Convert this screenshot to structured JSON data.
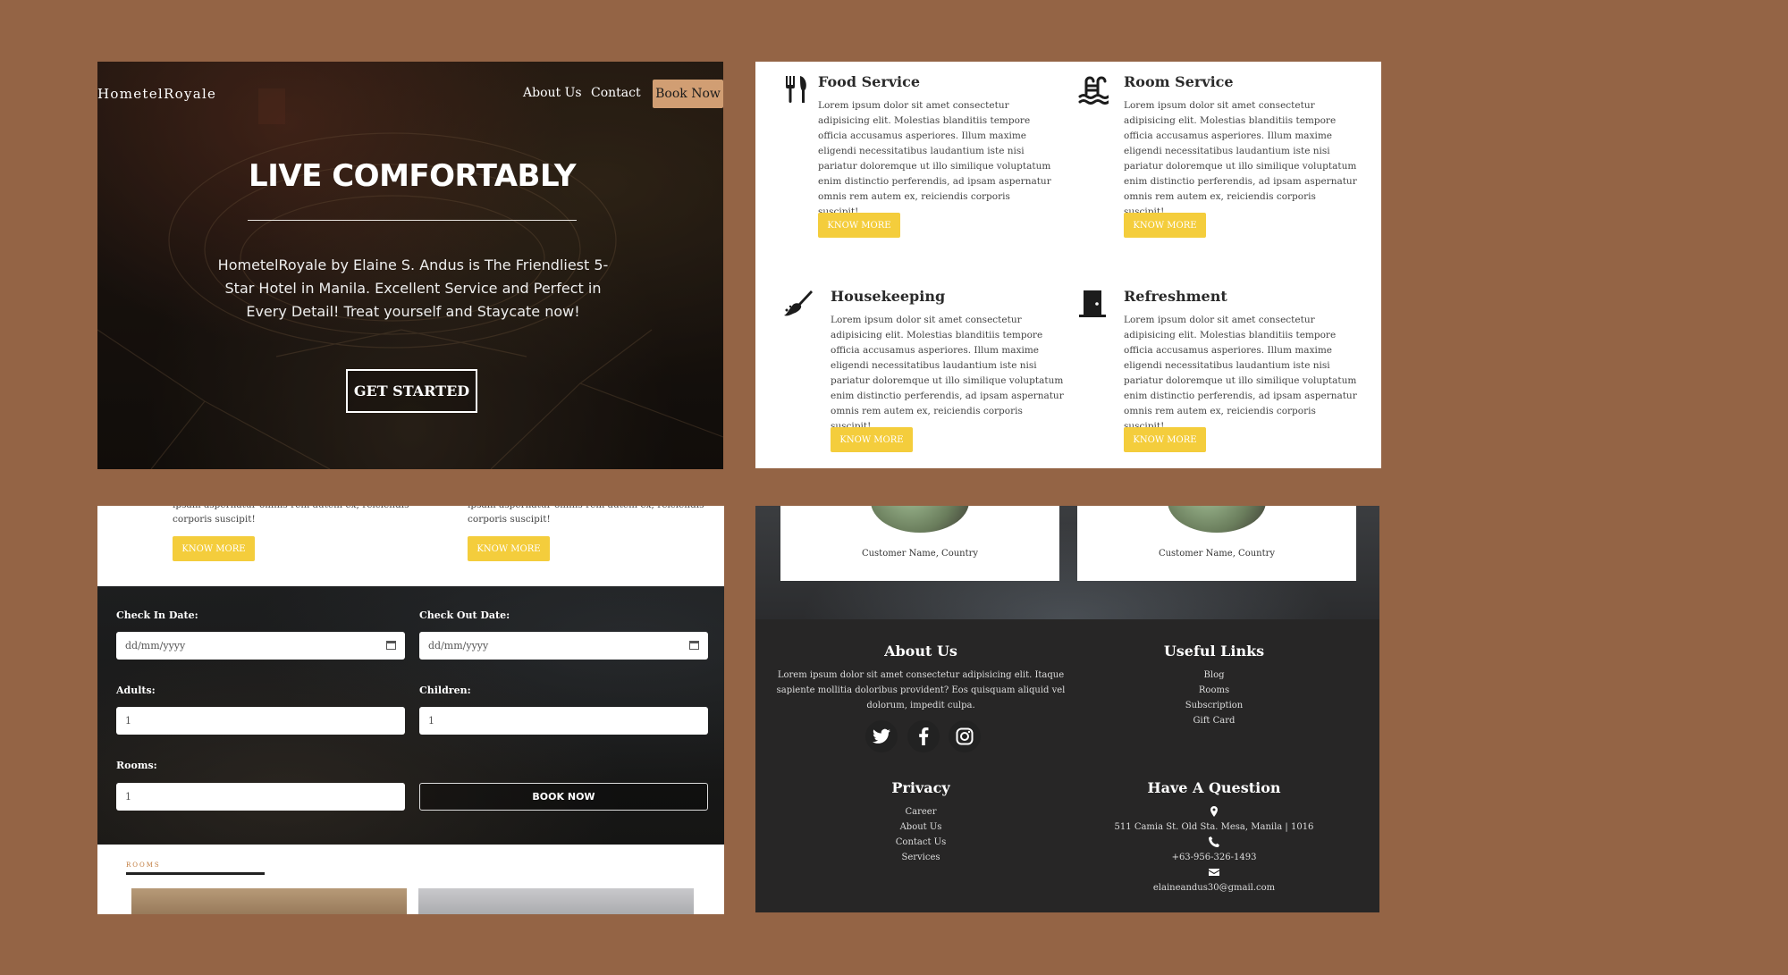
{
  "hero": {
    "brand": "HometelRoyale",
    "nav": [
      "About Us",
      "Contact"
    ],
    "book_now": "Book Now",
    "title": "LIVE COMFORTABLY",
    "description": "HometelRoyale by Elaine S. Andus is The Friendliest 5-Star Hotel in Manila. Excellent Service and Perfect in Every Detail! Treat yourself and Staycate now!",
    "cta": "GET STARTED"
  },
  "services": {
    "items": [
      {
        "title": "Food Service",
        "icon": "fork-knife-icon",
        "text": "Lorem ipsum dolor sit amet consectetur adipisicing elit. Molestias blanditiis tempore officia accusamus asperiores. Illum maxime eligendi necessitatibus laudantium iste nisi pariatur doloremque ut illo similique voluptatum enim distinctio perferendis, ad ipsam aspernatur omnis rem autem ex, reiciendis corporis suscipit!",
        "button": "KNOW MORE"
      },
      {
        "title": "Room Service",
        "icon": "swimming-pool-icon",
        "text": "Lorem ipsum dolor sit amet consectetur adipisicing elit. Molestias blanditiis tempore officia accusamus asperiores. Illum maxime eligendi necessitatibus laudantium iste nisi pariatur doloremque ut illo similique voluptatum enim distinctio perferendis, ad ipsam aspernatur omnis rem autem ex, reiciendis corporis suscipit!",
        "button": "KNOW MORE"
      },
      {
        "title": "Housekeeping",
        "icon": "broom-icon",
        "text": "Lorem ipsum dolor sit amet consectetur adipisicing elit. Molestias blanditiis tempore officia accusamus asperiores. Illum maxime eligendi necessitatibus laudantium iste nisi pariatur doloremque ut illo similique voluptatum enim distinctio perferendis, ad ipsam aspernatur omnis rem autem ex, reiciendis corporis suscipit!",
        "button": "KNOW MORE"
      },
      {
        "title": "Refreshment",
        "icon": "door-icon",
        "text": "Lorem ipsum dolor sit amet consectetur adipisicing elit. Molestias blanditiis tempore officia accusamus asperiores. Illum maxime eligendi necessitatibus laudantium iste nisi pariatur doloremque ut illo similique voluptatum enim distinctio perferendis, ad ipsam aspernatur omnis rem autem ex, reiciendis corporis suscipit!",
        "button": "KNOW MORE"
      }
    ]
  },
  "booking": {
    "top_text_cut": "ipsam aspernatur omnis rem autem ex, reiciendis",
    "top_text": "corporis suscipit!",
    "know_more": "KNOW MORE",
    "check_in_label": "Check In Date:",
    "check_out_label": "Check Out Date:",
    "date_placeholder": "dd/mm/yyyy",
    "adults_label": "Adults:",
    "children_label": "Children:",
    "rooms_label": "Rooms:",
    "adults_value": "1",
    "children_value": "1",
    "rooms_value": "1",
    "submit": "BOOK NOW",
    "rooms_section": "ROOMS"
  },
  "footer": {
    "customer_name": "Customer Name, Country",
    "about_heading": "About Us",
    "about_text": "Lorem ipsum dolor sit amet consectetur adipisicing elit. Itaque sapiente mollitia doloribus provident? Eos quisquam aliquid vel dolorum, impedit culpa.",
    "useful_heading": "Useful Links",
    "useful_links": [
      "Blog",
      "Rooms",
      "Subscription",
      "Gift Card"
    ],
    "privacy_heading": "Privacy",
    "privacy_links": [
      "Career",
      "About Us",
      "Contact Us",
      "Services"
    ],
    "question_heading": "Have A Question",
    "address": "511 Camia St. Old Sta. Mesa, Manila | 1016",
    "phone": "+63-956-326-1493",
    "email": "elaineandus30@gmail.com",
    "social": [
      "twitter-icon",
      "facebook-icon",
      "instagram-icon"
    ]
  },
  "colors": {
    "page_background": "#946445",
    "book_now_button": "#d19e73",
    "know_more_button": "#f4cd3c",
    "footer_background": "#272626",
    "rooms_label": "#c0793a"
  }
}
